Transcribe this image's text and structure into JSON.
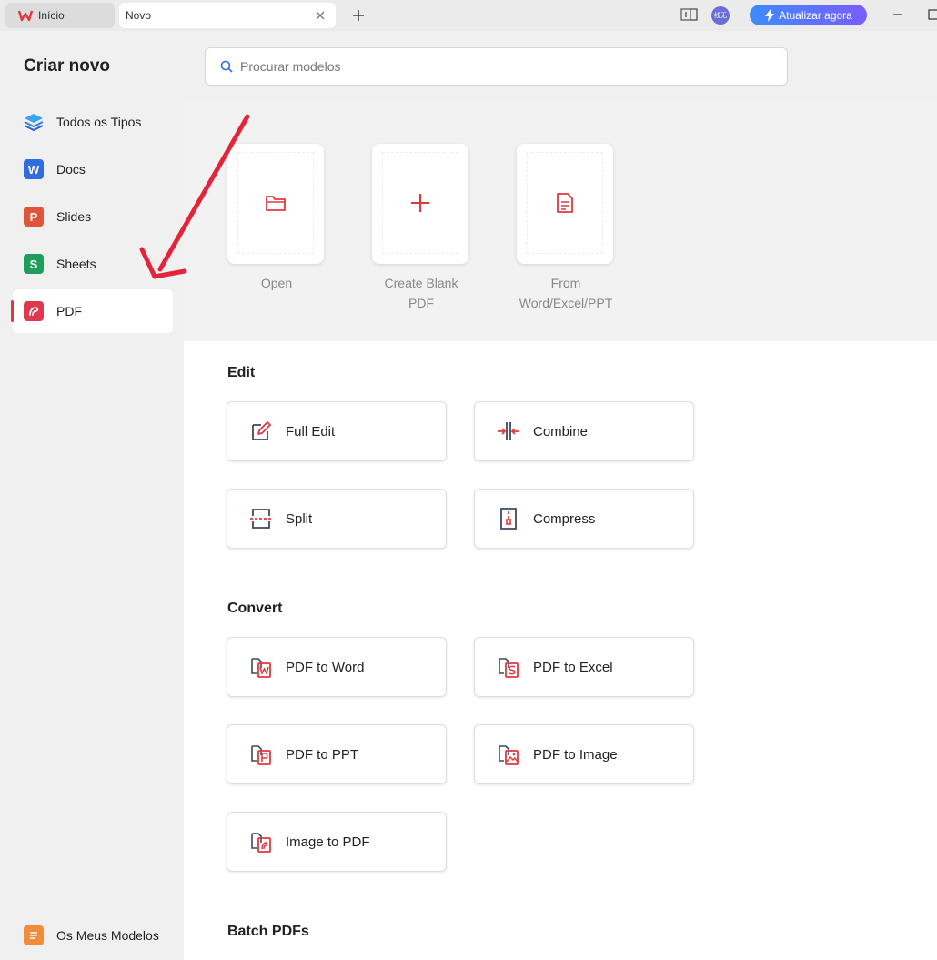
{
  "tabs": {
    "home_label": "Início",
    "current_label": "Novo"
  },
  "titlebar": {
    "upgrade_label": "Atualizar agora",
    "avatar_text": "线无"
  },
  "sidebar": {
    "title": "Criar novo",
    "items": [
      {
        "label": "Todos os Tipos",
        "icon": "layers-icon"
      },
      {
        "label": "Docs",
        "icon": "word-icon",
        "letter": "W",
        "color": "#2f6de0"
      },
      {
        "label": "Slides",
        "icon": "presentation-icon",
        "letter": "P",
        "color": "#e0553a"
      },
      {
        "label": "Sheets",
        "icon": "spreadsheet-icon",
        "letter": "S",
        "color": "#1e9e5a"
      },
      {
        "label": "PDF",
        "icon": "pdf-icon",
        "color": "#e0384f",
        "active": true
      }
    ],
    "templates_label": "Os Meus Modelos"
  },
  "search": {
    "placeholder": "Procurar modelos"
  },
  "quick_cards": [
    {
      "label": "Open",
      "icon": "folder-icon"
    },
    {
      "label": "Create Blank PDF",
      "icon": "plus-icon"
    },
    {
      "label": "From Word/Excel/PPT",
      "icon": "document-icon"
    }
  ],
  "sections": {
    "edit": {
      "title": "Edit",
      "tools": [
        "Full Edit",
        "Combine",
        "Split",
        "Compress"
      ]
    },
    "convert": {
      "title": "Convert",
      "tools": [
        "PDF to Word",
        "PDF to Excel",
        "PDF to PPT",
        "PDF to Image",
        "Image to PDF"
      ]
    },
    "batch": {
      "title": "Batch PDFs"
    }
  },
  "colors": {
    "accent_red": "#e0383e",
    "icon_dark": "#3c4b5e",
    "upgrade_gradient_start": "#3d8bff",
    "upgrade_gradient_end": "#7a5cff"
  }
}
